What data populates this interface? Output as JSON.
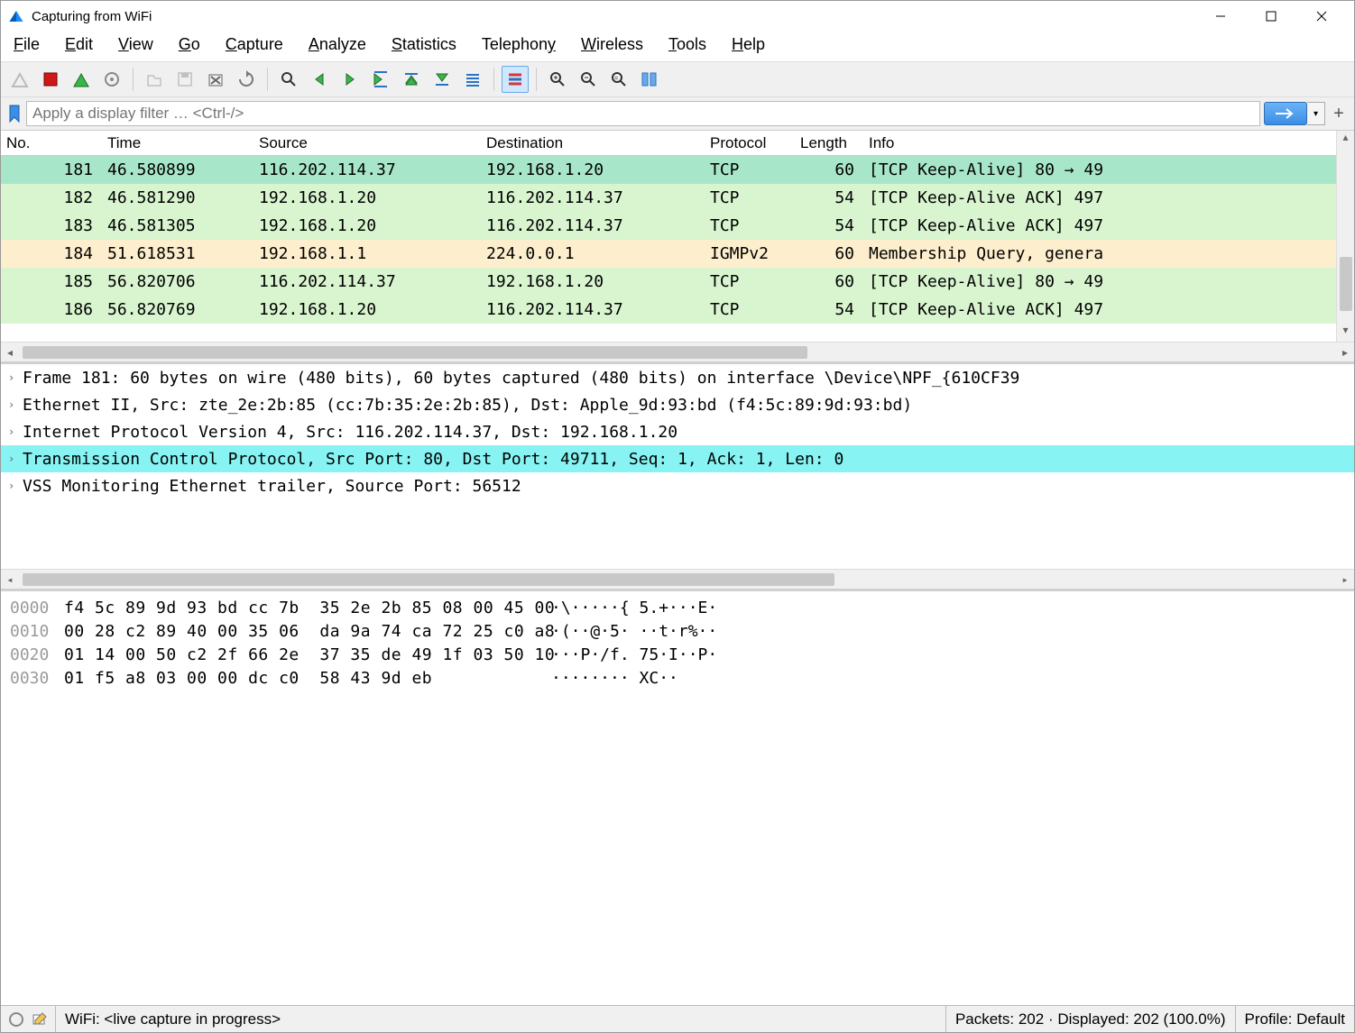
{
  "window": {
    "title": "Capturing from WiFi"
  },
  "menu": [
    "File",
    "Edit",
    "View",
    "Go",
    "Capture",
    "Analyze",
    "Statistics",
    "Telephony",
    "Wireless",
    "Tools",
    "Help"
  ],
  "filter": {
    "placeholder": "Apply a display filter … <Ctrl-/>"
  },
  "packet_columns": [
    "No.",
    "Time",
    "Source",
    "Destination",
    "Protocol",
    "Length",
    "Info"
  ],
  "packets": [
    {
      "no": "181",
      "time": "46.580899",
      "src": "116.202.114.37",
      "dst": "192.168.1.20",
      "proto": "TCP",
      "len": "60",
      "info": "[TCP Keep-Alive] 80 → 49",
      "cls": "row-green-a"
    },
    {
      "no": "182",
      "time": "46.581290",
      "src": "192.168.1.20",
      "dst": "116.202.114.37",
      "proto": "TCP",
      "len": "54",
      "info": "[TCP Keep-Alive ACK] 497",
      "cls": "row-green-b"
    },
    {
      "no": "183",
      "time": "46.581305",
      "src": "192.168.1.20",
      "dst": "116.202.114.37",
      "proto": "TCP",
      "len": "54",
      "info": "[TCP Keep-Alive ACK] 497",
      "cls": "row-green-b"
    },
    {
      "no": "184",
      "time": "51.618531",
      "src": "192.168.1.1",
      "dst": "224.0.0.1",
      "proto": "IGMPv2",
      "len": "60",
      "info": "Membership Query, genera",
      "cls": "row-cream"
    },
    {
      "no": "185",
      "time": "56.820706",
      "src": "116.202.114.37",
      "dst": "192.168.1.20",
      "proto": "TCP",
      "len": "60",
      "info": "[TCP Keep-Alive] 80 → 49",
      "cls": "row-green-b"
    },
    {
      "no": "186",
      "time": "56.820769",
      "src": "192.168.1.20",
      "dst": "116.202.114.37",
      "proto": "TCP",
      "len": "54",
      "info": "[TCP Keep-Alive ACK] 497",
      "cls": "row-green-b"
    }
  ],
  "details": [
    {
      "text": "Frame 181: 60 bytes on wire (480 bits), 60 bytes captured (480 bits) on interface \\Device\\NPF_{610CF39",
      "hl": false
    },
    {
      "text": "Ethernet II, Src: zte_2e:2b:85 (cc:7b:35:2e:2b:85), Dst: Apple_9d:93:bd (f4:5c:89:9d:93:bd)",
      "hl": false
    },
    {
      "text": "Internet Protocol Version 4, Src: 116.202.114.37, Dst: 192.168.1.20",
      "hl": false
    },
    {
      "text": "Transmission Control Protocol, Src Port: 80, Dst Port: 49711, Seq: 1, Ack: 1, Len: 0",
      "hl": true
    },
    {
      "text": "VSS Monitoring Ethernet trailer, Source Port: 56512",
      "hl": false
    }
  ],
  "hex": [
    {
      "off": "0000",
      "bytes": "f4 5c 89 9d 93 bd cc 7b  35 2e 2b 85 08 00 45 00",
      "ascii": "·\\·····{ 5.+···E·"
    },
    {
      "off": "0010",
      "bytes": "00 28 c2 89 40 00 35 06  da 9a 74 ca 72 25 c0 a8",
      "ascii": "·(··@·5· ··t·r%··"
    },
    {
      "off": "0020",
      "bytes": "01 14 00 50 c2 2f 66 2e  37 35 de 49 1f 03 50 10",
      "ascii": "···P·/f. 75·I··P·"
    },
    {
      "off": "0030",
      "bytes": "01 f5 a8 03 00 00 dc c0  58 43 9d eb",
      "ascii": "········ XC··"
    }
  ],
  "status": {
    "iface": "WiFi: <live capture in progress>",
    "packets": "Packets: 202 · Displayed: 202 (100.0%)",
    "profile": "Profile: Default"
  }
}
